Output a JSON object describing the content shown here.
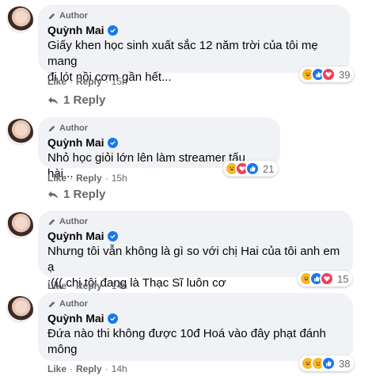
{
  "comments": [
    {
      "badge": "Author",
      "name": "Quỳnh Mai",
      "text": "Giấy khen học sinh xuất sắc 12 năm trời của tôi mẹ mang\nđi lót nồi cơm gần hết...",
      "reaction_count": "39",
      "reactions": [
        "haha-icon",
        "like-icon",
        "love-icon"
      ],
      "like": "Like",
      "reply": "Reply",
      "time": "15h",
      "replies": "1 Reply"
    },
    {
      "badge": "Author",
      "name": "Quỳnh Mai",
      "text": "Nhỏ học giỏi lớn lên làm streamer tấu hài...",
      "reaction_count": "21",
      "reactions": [
        "haha-icon",
        "love-icon",
        "like-icon"
      ],
      "like": "Like",
      "reply": "Reply",
      "time": "15h",
      "replies": "1 Reply"
    },
    {
      "badge": "Author",
      "name": "Quỳnh Mai",
      "text": "Nhưng tôi vẫn không là gì so với chị Hai của tôi anh em ạ\n:((( chị tôi đang là Thạc Sĩ luôn cơ",
      "reaction_count": "15",
      "reactions": [
        "haha-icon",
        "like-icon",
        "love-icon"
      ],
      "like": "Like",
      "reply": "Reply",
      "time": "14h"
    },
    {
      "badge": "Author",
      "name": "Quỳnh Mai",
      "text": "Đứa nào thi không được 10đ Hoá vào đây phạt đánh\nmông",
      "reaction_count": "38",
      "reactions": [
        "haha-icon",
        "sad-icon",
        "like-icon"
      ],
      "like": "Like",
      "reply": "Reply",
      "time": "14h"
    }
  ],
  "colors": {
    "bubble": "#f0f2f5",
    "meta": "#65676b",
    "verified": "#1877f2",
    "haha": "#f7b928",
    "love": "#f33e58"
  }
}
